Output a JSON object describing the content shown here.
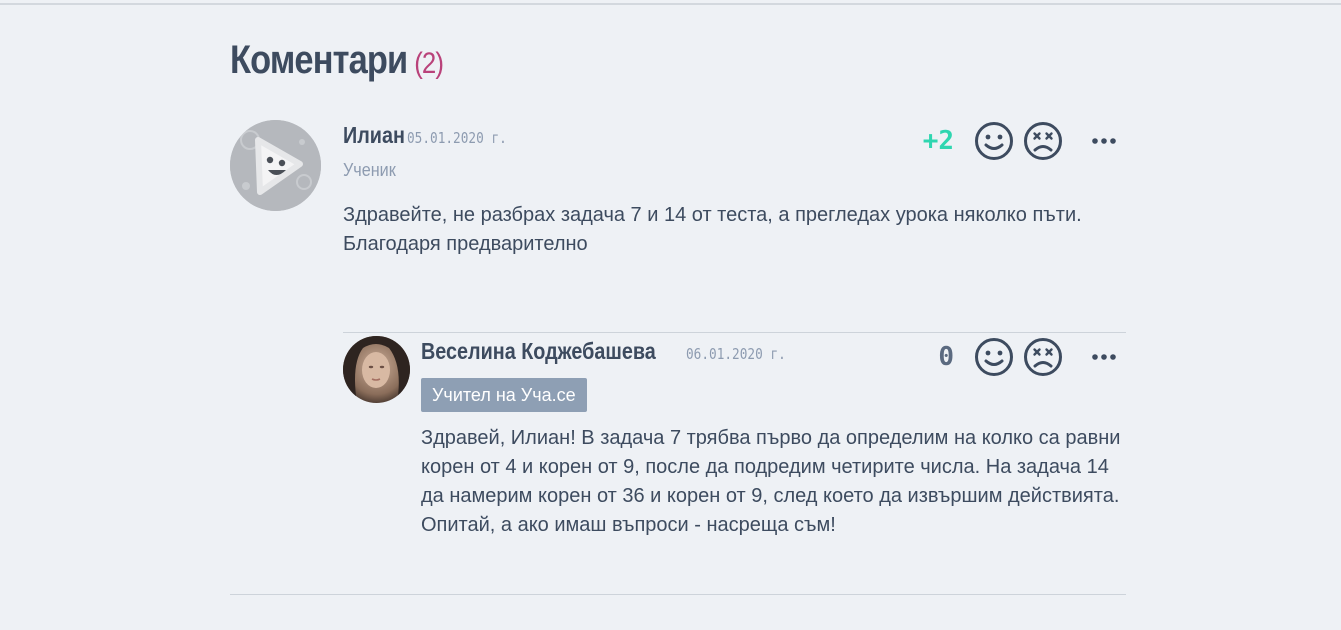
{
  "comments_section": {
    "title": "Коментари",
    "count": "(2)"
  },
  "comments": [
    {
      "author": "Илиан",
      "date": "05.01.2020 г.",
      "role": "Ученик",
      "score": "+2",
      "text": "Здравейте, не разбрах задача 7 и 14 от теста, а прегледах урока няколко пъти. Благодаря предварително"
    },
    {
      "author": "Веселина Коджебашева",
      "date": "06.01.2020 г.",
      "badge": "Учител на Уча.се",
      "score": "0",
      "text": "Здравей, Илиан! В задача 7 трябва първо да определим на колко са равни корен от 4 и корен от 9, после да подредим четирите числа. На задача 14 да намерим корен от 36 и корен от 9, след което да извършим действията. Опитай, а ако имаш въпроси - насреща съм!"
    }
  ],
  "icons": {
    "like": "smile-icon",
    "dislike": "dead-face-icon",
    "more": "more-dots-icon"
  },
  "colors": {
    "positive_score": "#2fd6b0",
    "count_accent": "#b9427a",
    "badge_bg": "#8e9fb4"
  }
}
